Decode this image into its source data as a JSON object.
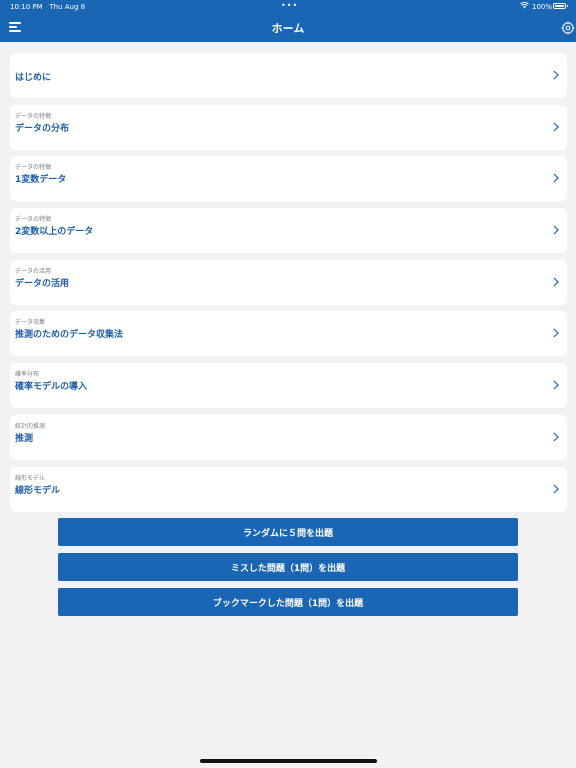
{
  "status": {
    "time": "10:10 PM",
    "date": "Thu Aug 8",
    "dots": "•••",
    "battery": "100%"
  },
  "header": {
    "title": "ホーム",
    "menu_icon": "hamburger-menu-icon",
    "settings_icon": "gear-icon"
  },
  "topics": [
    {
      "category": "",
      "label": "はじめに"
    },
    {
      "category": "データの特徴",
      "label": "データの分布"
    },
    {
      "category": "データの特徴",
      "label": "1変数データ"
    },
    {
      "category": "データの特徴",
      "label": "2変数以上のデータ"
    },
    {
      "category": "データの活用",
      "label": "データの活用"
    },
    {
      "category": "データ収集",
      "label": "推測のためのデータ収集法"
    },
    {
      "category": "確率分布",
      "label": "確率モデルの導入"
    },
    {
      "category": "統計的推測",
      "label": "推測"
    },
    {
      "category": "線形モデル",
      "label": "線形モデル"
    }
  ],
  "actions": {
    "random": "ランダムに５問を出題",
    "mistakes": "ミスした問題（1問）を出題",
    "bookmarks": "ブックマークした問題（1問）を出題"
  },
  "colors": {
    "accent": "#1a66b5",
    "label": "#1f5fa6",
    "background": "#f2f2f4"
  }
}
